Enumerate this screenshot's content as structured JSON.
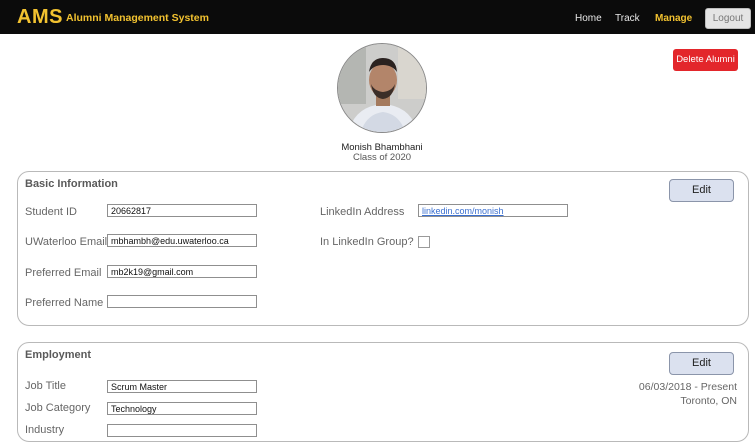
{
  "header": {
    "brand": "AMS",
    "subtitle": "Alumni Management System",
    "nav": [
      "Home",
      "Track",
      "Manage"
    ],
    "logout_label": "Logout",
    "accent_color": "#f2c230"
  },
  "profile": {
    "name": "Monish Bhambhani",
    "class_year": "Class of 2020",
    "delete_label": "Delete Alumni"
  },
  "basic": {
    "title": "Basic Information",
    "edit_label": "Edit",
    "student_id_label": "Student ID",
    "student_id": "20662817",
    "uw_email_label": "UWaterloo Email",
    "uw_email": "mbhambh@edu.uwaterloo.ca",
    "pref_email_label": "Preferred Email",
    "pref_email": "mb2k19@gmail.com",
    "pref_name_label": "Preferred Name",
    "pref_name": "",
    "linkedin_label": "LinkedIn Address",
    "linkedin": "linkedin.com/monish",
    "group_label": "In LinkedIn Group?",
    "in_group": false
  },
  "employment": {
    "title": "Employment",
    "edit_label": "Edit",
    "job_title_label": "Job Title",
    "job_title": "Scrum Master",
    "job_category_label": "Job Category",
    "job_category": "Technology",
    "industry_label": "Industry",
    "dates": "06/03/2018 - Present",
    "location": "Toronto, ON"
  }
}
